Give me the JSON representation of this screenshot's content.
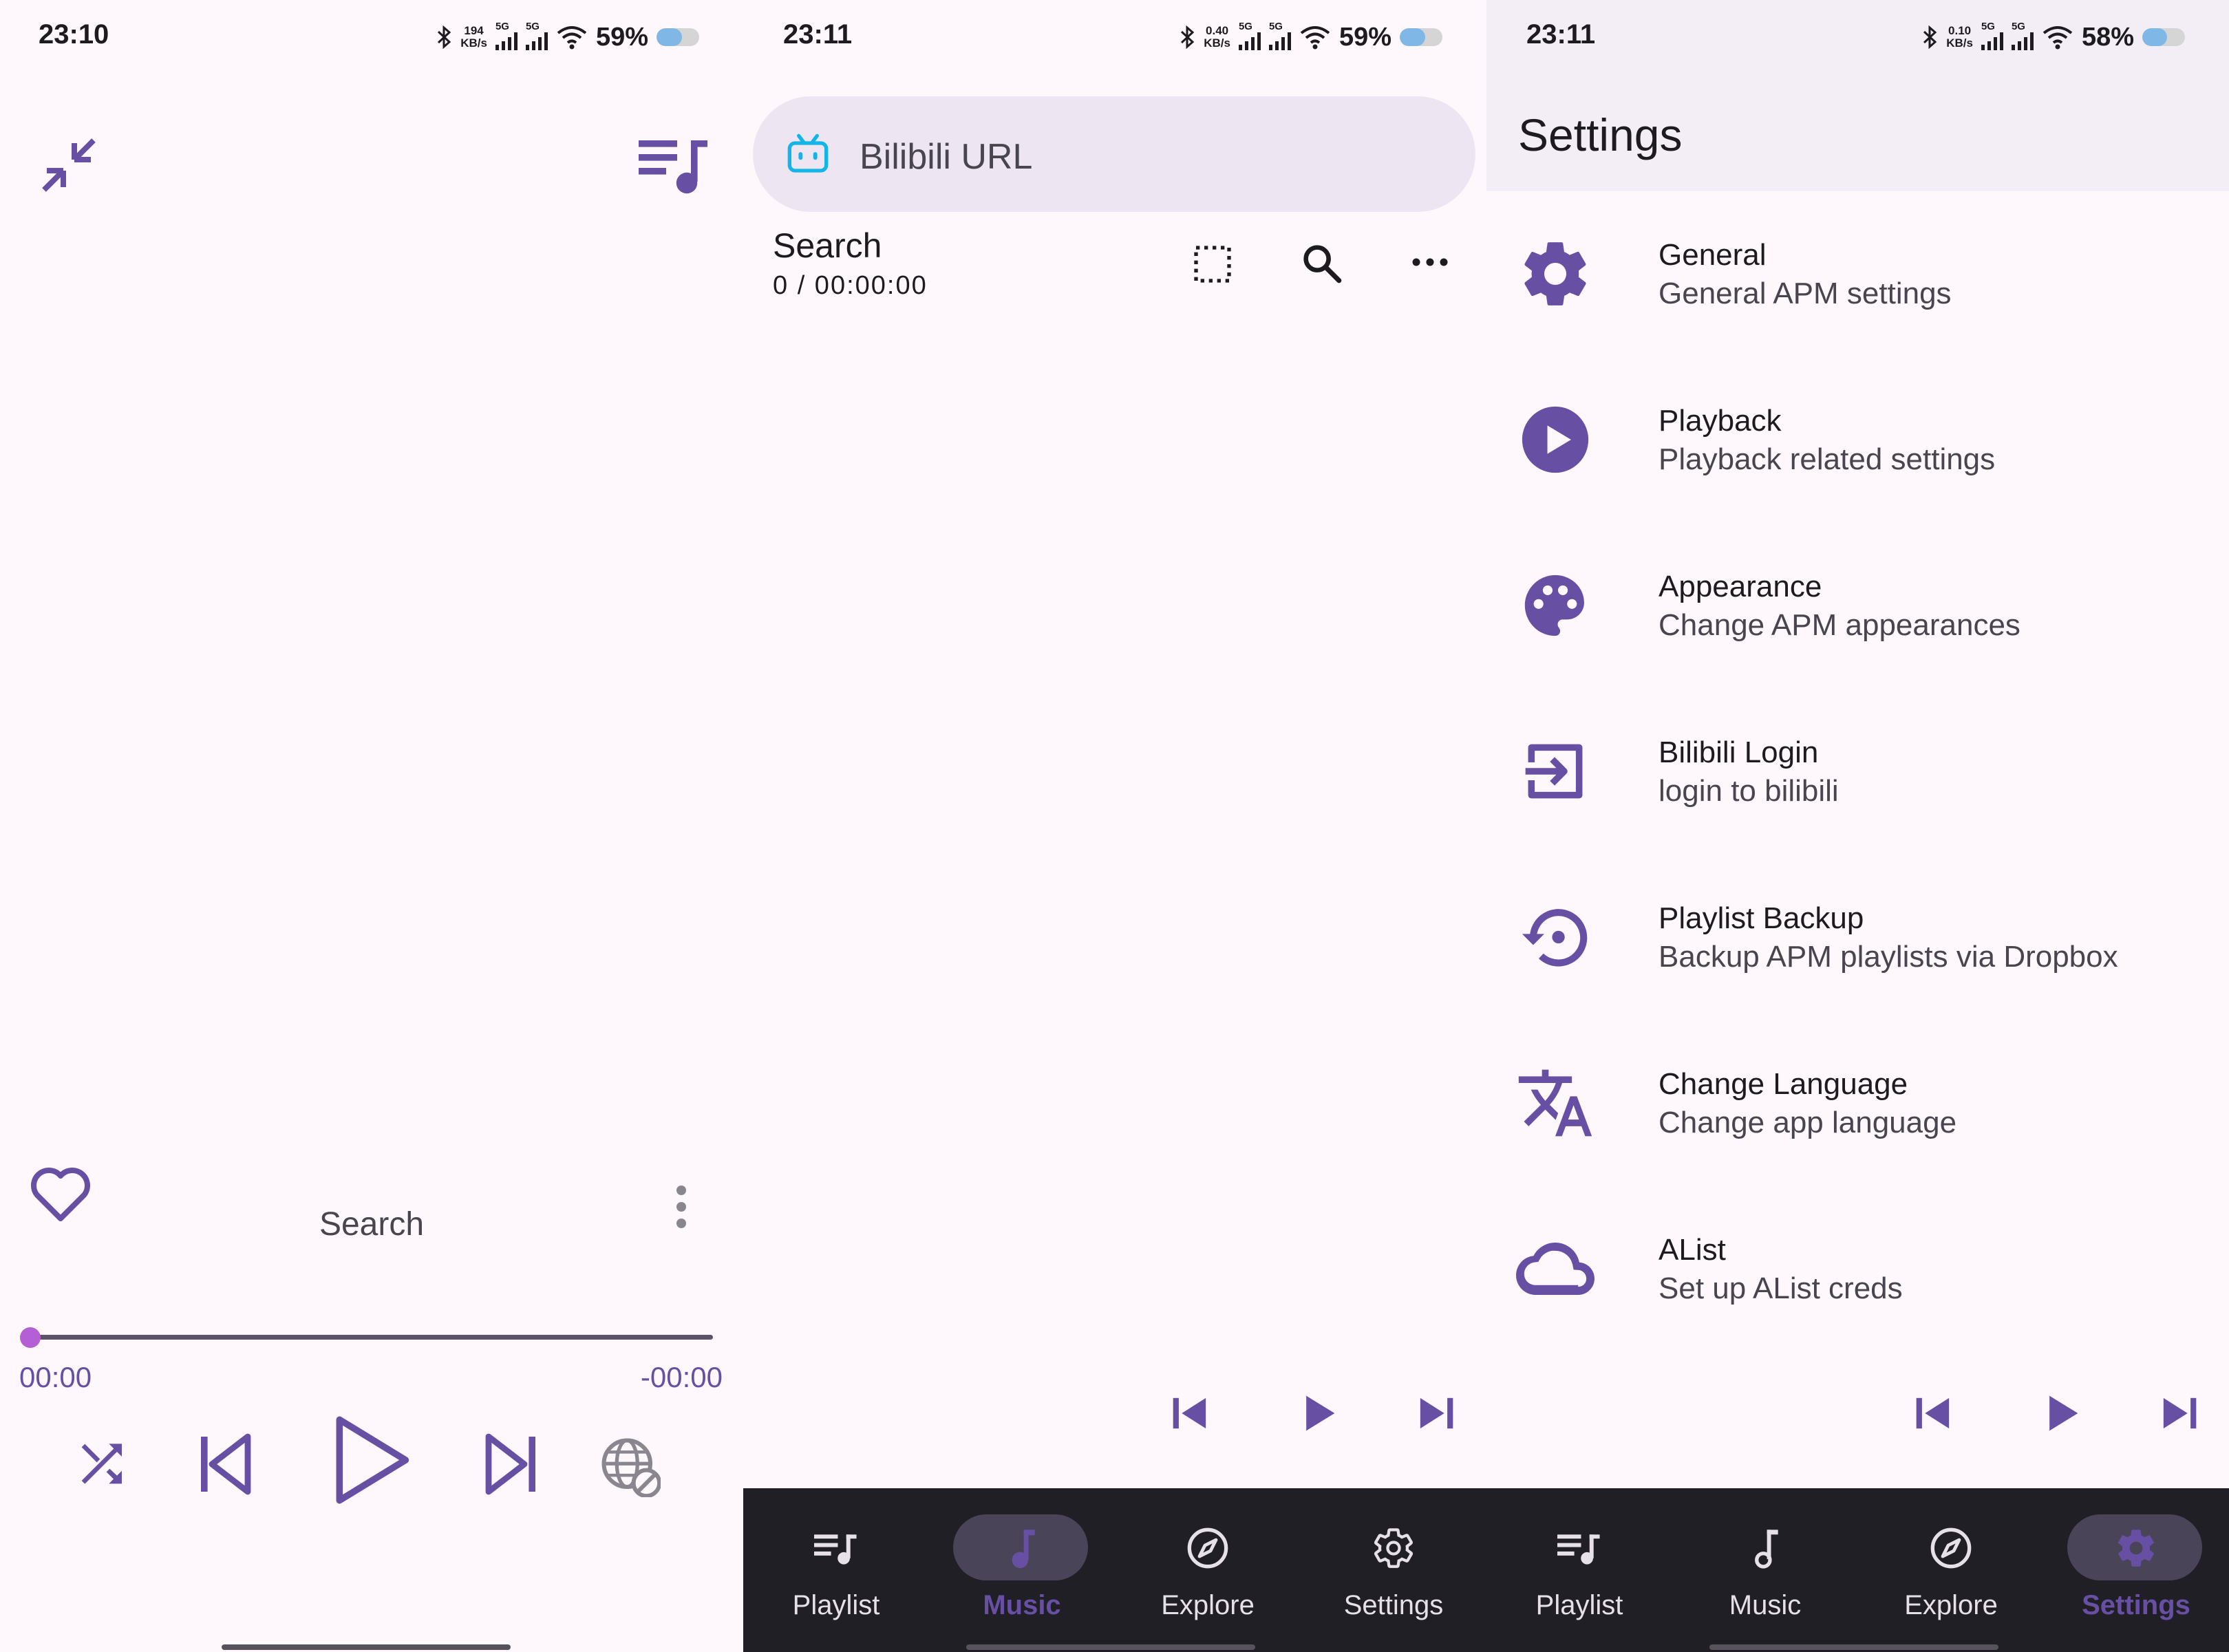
{
  "colors": {
    "accent": "#6750a4",
    "background": "#fef7fc",
    "nav_bg": "#211f26",
    "seek_knob": "#b45fd6",
    "bilibili_blue": "#12b5e5"
  },
  "player": {
    "status": {
      "time": "23:10",
      "speed_top": "194",
      "speed_unit": "KB/s",
      "net1": "5G",
      "net2": "5G",
      "battery": "59%",
      "battery_level": 0.59
    },
    "minimize_icon": "collapse-arrows-icon",
    "queue_icon": "queue-music-icon",
    "track_title": "Search",
    "time_elapsed": "00:00",
    "time_remaining": "-00:00",
    "progress": 0.0
  },
  "music": {
    "status": {
      "time": "23:11",
      "speed_top": "0.40",
      "speed_unit": "KB/s",
      "net1": "5G",
      "net2": "5G",
      "battery": "59%",
      "battery_level": 0.59
    },
    "url_placeholder": "Bilibili URL",
    "list_title": "Search",
    "list_meta": "0 / 00:00:00"
  },
  "settings": {
    "status": {
      "time": "23:11",
      "speed_top": "0.10",
      "speed_unit": "KB/s",
      "net1": "5G",
      "net2": "5G",
      "battery": "58%",
      "battery_level": 0.58
    },
    "title": "Settings",
    "items": [
      {
        "title": "General",
        "subtitle": "General APM settings",
        "icon": "gear-icon"
      },
      {
        "title": "Playback",
        "subtitle": "Playback related settings",
        "icon": "play-circle-icon"
      },
      {
        "title": "Appearance",
        "subtitle": "Change APM appearances",
        "icon": "palette-icon"
      },
      {
        "title": "Bilibili Login",
        "subtitle": "login to bilibili",
        "icon": "login-icon"
      },
      {
        "title": "Playlist Backup",
        "subtitle": "Backup APM playlists via Dropbox",
        "icon": "backup-restore-icon"
      },
      {
        "title": "Change Language",
        "subtitle": "Change app language",
        "icon": "translate-icon"
      },
      {
        "title": "AList",
        "subtitle": "Set up AList creds",
        "icon": "cloud-icon"
      }
    ]
  },
  "nav": {
    "playlist": "Playlist",
    "music": "Music",
    "explore": "Explore",
    "settings": "Settings"
  }
}
